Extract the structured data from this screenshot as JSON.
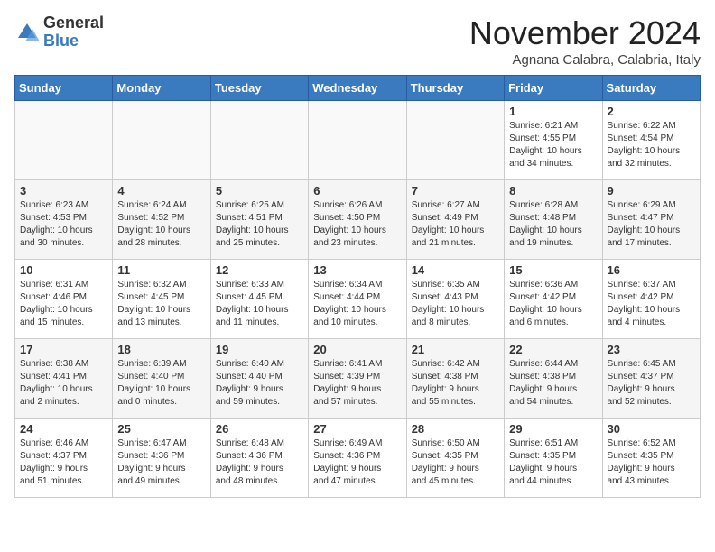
{
  "logo": {
    "general": "General",
    "blue": "Blue"
  },
  "title": "November 2024",
  "subtitle": "Agnana Calabra, Calabria, Italy",
  "days_of_week": [
    "Sunday",
    "Monday",
    "Tuesday",
    "Wednesday",
    "Thursday",
    "Friday",
    "Saturday"
  ],
  "weeks": [
    [
      {
        "day": "",
        "info": ""
      },
      {
        "day": "",
        "info": ""
      },
      {
        "day": "",
        "info": ""
      },
      {
        "day": "",
        "info": ""
      },
      {
        "day": "",
        "info": ""
      },
      {
        "day": "1",
        "info": "Sunrise: 6:21 AM\nSunset: 4:55 PM\nDaylight: 10 hours\nand 34 minutes."
      },
      {
        "day": "2",
        "info": "Sunrise: 6:22 AM\nSunset: 4:54 PM\nDaylight: 10 hours\nand 32 minutes."
      }
    ],
    [
      {
        "day": "3",
        "info": "Sunrise: 6:23 AM\nSunset: 4:53 PM\nDaylight: 10 hours\nand 30 minutes."
      },
      {
        "day": "4",
        "info": "Sunrise: 6:24 AM\nSunset: 4:52 PM\nDaylight: 10 hours\nand 28 minutes."
      },
      {
        "day": "5",
        "info": "Sunrise: 6:25 AM\nSunset: 4:51 PM\nDaylight: 10 hours\nand 25 minutes."
      },
      {
        "day": "6",
        "info": "Sunrise: 6:26 AM\nSunset: 4:50 PM\nDaylight: 10 hours\nand 23 minutes."
      },
      {
        "day": "7",
        "info": "Sunrise: 6:27 AM\nSunset: 4:49 PM\nDaylight: 10 hours\nand 21 minutes."
      },
      {
        "day": "8",
        "info": "Sunrise: 6:28 AM\nSunset: 4:48 PM\nDaylight: 10 hours\nand 19 minutes."
      },
      {
        "day": "9",
        "info": "Sunrise: 6:29 AM\nSunset: 4:47 PM\nDaylight: 10 hours\nand 17 minutes."
      }
    ],
    [
      {
        "day": "10",
        "info": "Sunrise: 6:31 AM\nSunset: 4:46 PM\nDaylight: 10 hours\nand 15 minutes."
      },
      {
        "day": "11",
        "info": "Sunrise: 6:32 AM\nSunset: 4:45 PM\nDaylight: 10 hours\nand 13 minutes."
      },
      {
        "day": "12",
        "info": "Sunrise: 6:33 AM\nSunset: 4:45 PM\nDaylight: 10 hours\nand 11 minutes."
      },
      {
        "day": "13",
        "info": "Sunrise: 6:34 AM\nSunset: 4:44 PM\nDaylight: 10 hours\nand 10 minutes."
      },
      {
        "day": "14",
        "info": "Sunrise: 6:35 AM\nSunset: 4:43 PM\nDaylight: 10 hours\nand 8 minutes."
      },
      {
        "day": "15",
        "info": "Sunrise: 6:36 AM\nSunset: 4:42 PM\nDaylight: 10 hours\nand 6 minutes."
      },
      {
        "day": "16",
        "info": "Sunrise: 6:37 AM\nSunset: 4:42 PM\nDaylight: 10 hours\nand 4 minutes."
      }
    ],
    [
      {
        "day": "17",
        "info": "Sunrise: 6:38 AM\nSunset: 4:41 PM\nDaylight: 10 hours\nand 2 minutes."
      },
      {
        "day": "18",
        "info": "Sunrise: 6:39 AM\nSunset: 4:40 PM\nDaylight: 10 hours\nand 0 minutes."
      },
      {
        "day": "19",
        "info": "Sunrise: 6:40 AM\nSunset: 4:40 PM\nDaylight: 9 hours\nand 59 minutes."
      },
      {
        "day": "20",
        "info": "Sunrise: 6:41 AM\nSunset: 4:39 PM\nDaylight: 9 hours\nand 57 minutes."
      },
      {
        "day": "21",
        "info": "Sunrise: 6:42 AM\nSunset: 4:38 PM\nDaylight: 9 hours\nand 55 minutes."
      },
      {
        "day": "22",
        "info": "Sunrise: 6:44 AM\nSunset: 4:38 PM\nDaylight: 9 hours\nand 54 minutes."
      },
      {
        "day": "23",
        "info": "Sunrise: 6:45 AM\nSunset: 4:37 PM\nDaylight: 9 hours\nand 52 minutes."
      }
    ],
    [
      {
        "day": "24",
        "info": "Sunrise: 6:46 AM\nSunset: 4:37 PM\nDaylight: 9 hours\nand 51 minutes."
      },
      {
        "day": "25",
        "info": "Sunrise: 6:47 AM\nSunset: 4:36 PM\nDaylight: 9 hours\nand 49 minutes."
      },
      {
        "day": "26",
        "info": "Sunrise: 6:48 AM\nSunset: 4:36 PM\nDaylight: 9 hours\nand 48 minutes."
      },
      {
        "day": "27",
        "info": "Sunrise: 6:49 AM\nSunset: 4:36 PM\nDaylight: 9 hours\nand 47 minutes."
      },
      {
        "day": "28",
        "info": "Sunrise: 6:50 AM\nSunset: 4:35 PM\nDaylight: 9 hours\nand 45 minutes."
      },
      {
        "day": "29",
        "info": "Sunrise: 6:51 AM\nSunset: 4:35 PM\nDaylight: 9 hours\nand 44 minutes."
      },
      {
        "day": "30",
        "info": "Sunrise: 6:52 AM\nSunset: 4:35 PM\nDaylight: 9 hours\nand 43 minutes."
      }
    ]
  ]
}
